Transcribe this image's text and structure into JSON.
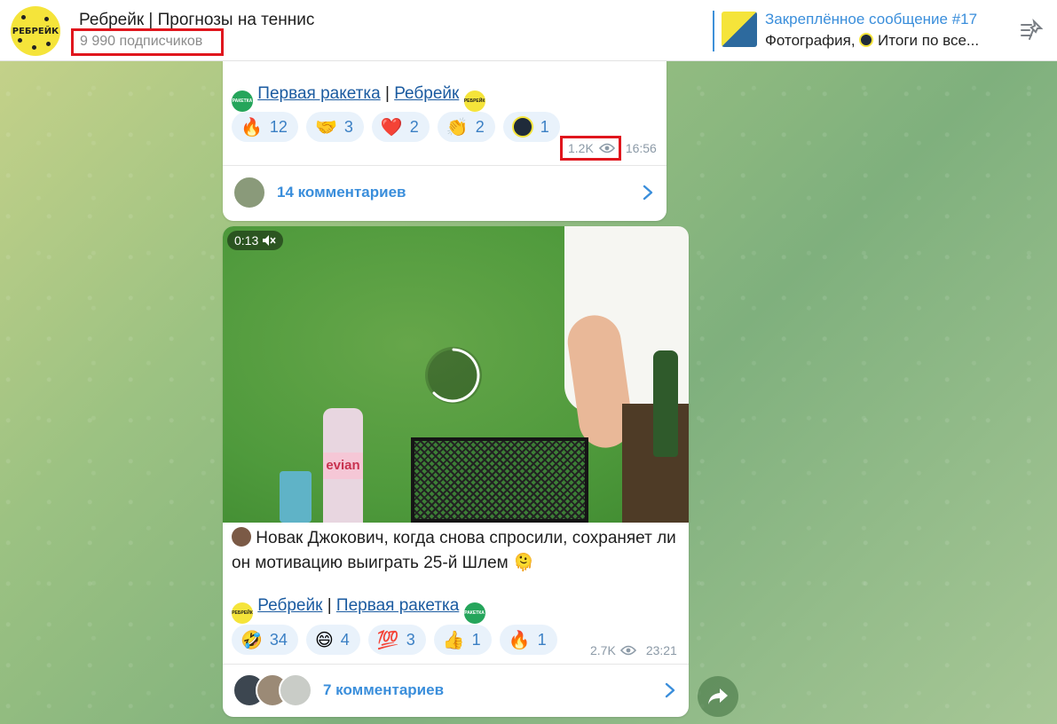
{
  "header": {
    "channel_title": "Ребрейк | Прогнозы на теннис",
    "subscribers": "9 990 подписчиков",
    "avatar_text": "РЕБРЕЙК",
    "pinned_title": "Закреплённое сообщение #17",
    "pinned_text": "Фотография, ",
    "pinned_text_tail": "Итоги по все..."
  },
  "message1": {
    "link_first": "Первая ракетка",
    "separator": "|",
    "link_second": "Ребрейк",
    "reactions": [
      {
        "icon": "fire-emoji",
        "glyph": "🔥",
        "count": "12"
      },
      {
        "icon": "handshake-emoji",
        "glyph": "🤝",
        "count": "3"
      },
      {
        "icon": "heart-emoji",
        "glyph": "❤️",
        "count": "2"
      },
      {
        "icon": "clap-emoji",
        "glyph": "👏",
        "count": "2"
      },
      {
        "icon": "rebreak-avatar-emoji",
        "glyph": "",
        "count": "1"
      }
    ],
    "views": "1.2K",
    "time": "16:56",
    "comments": "14 комментариев"
  },
  "message2": {
    "video_duration": "0:13",
    "caption": "Новак Джокович, когда снова спросили, сохраняет ли он мотивацию выиграть 25-й Шлем",
    "caption_emoji": "🫠",
    "link_first": "Ребрейк",
    "separator": "|",
    "link_second": "Первая ракетка",
    "reactions": [
      {
        "icon": "rofl-emoji",
        "glyph": "🤣",
        "count": "34"
      },
      {
        "icon": "grin-emoji",
        "glyph": "😄",
        "count": "4"
      },
      {
        "icon": "hundred-emoji",
        "glyph": "💯",
        "count": "3"
      },
      {
        "icon": "thumbs-up-emoji",
        "glyph": "👍",
        "count": "1"
      },
      {
        "icon": "fire-emoji",
        "glyph": "🔥",
        "count": "1"
      }
    ],
    "views": "2.7K",
    "time": "23:21",
    "comments": "7 комментариев"
  },
  "colors": {
    "accent": "#3a8edb",
    "highlight_box": "#e0161d",
    "brand_yellow": "#f5e43a",
    "brand_green": "#25a55b"
  }
}
